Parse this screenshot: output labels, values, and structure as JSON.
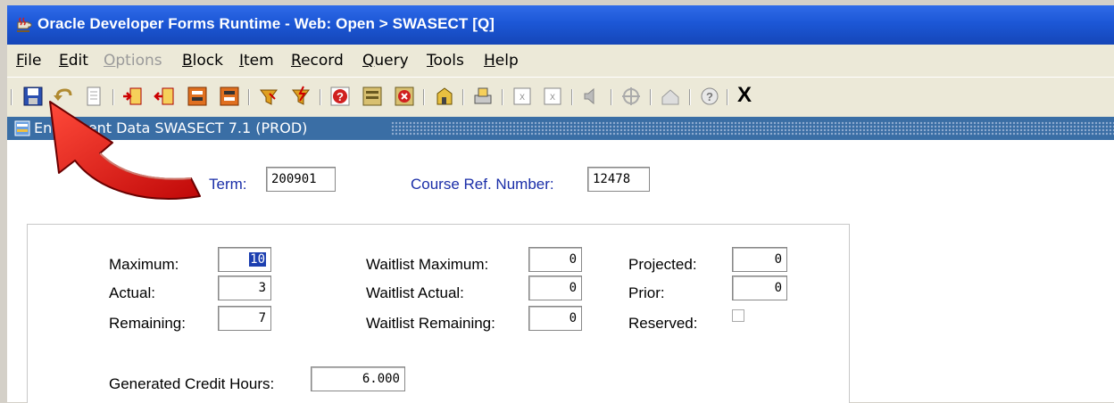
{
  "window": {
    "title": "Oracle Developer Forms Runtime - Web:  Open > SWASECT [Q]"
  },
  "menu": [
    {
      "label": "File",
      "mnemonic": "F",
      "rest": "ile",
      "disabled": false
    },
    {
      "label": "Edit",
      "mnemonic": "E",
      "rest": "dit",
      "disabled": false
    },
    {
      "label": "Options",
      "mnemonic": "O",
      "rest": "ptions",
      "disabled": true
    },
    {
      "label": "Block",
      "mnemonic": "B",
      "rest": "lock",
      "disabled": false
    },
    {
      "label": "Item",
      "mnemonic": "I",
      "rest": "tem",
      "disabled": false
    },
    {
      "label": "Record",
      "mnemonic": "R",
      "rest": "ecord",
      "disabled": false
    },
    {
      "label": "Query",
      "mnemonic": "Q",
      "rest": "uery",
      "disabled": false
    },
    {
      "label": "Tools",
      "mnemonic": "T",
      "rest": "ools",
      "disabled": false
    },
    {
      "label": "Help",
      "mnemonic": "H",
      "rest": "elp",
      "disabled": false
    }
  ],
  "toolbar": {
    "exit_label": "X",
    "icons": [
      "save-icon",
      "rollback-icon",
      "print-icon",
      "insert-record-icon",
      "remove-record-icon",
      "previous-block-icon",
      "next-block-icon",
      "enter-query-icon",
      "execute-query-icon",
      "help-icon",
      "select-icon",
      "cancel-query-icon",
      "copy-icon",
      "print-screen-icon",
      "export-icon",
      "clear-icon",
      "speaker-icon",
      "target-icon",
      "home-icon",
      "question-icon"
    ]
  },
  "form": {
    "title": "Enrollment Data  SWASECT  7.1  (PROD)",
    "term_label": "Term:",
    "term_value": "200901",
    "crn_label": "Course Ref. Number:",
    "crn_value": "12478",
    "maximum_label": "Maximum:",
    "maximum_value": "10",
    "actual_label": "Actual:",
    "actual_value": "3",
    "remaining_label": "Remaining:",
    "remaining_value": "7",
    "wl_maximum_label": "Waitlist Maximum:",
    "wl_maximum_value": "0",
    "wl_actual_label": "Waitlist Actual:",
    "wl_actual_value": "0",
    "wl_remaining_label": "Waitlist Remaining:",
    "wl_remaining_value": "0",
    "projected_label": "Projected:",
    "projected_value": "0",
    "prior_label": "Prior:",
    "prior_value": "0",
    "reserved_label": "Reserved:",
    "reserved_checked": false,
    "credit_hours_label": "Generated Credit Hours:",
    "credit_hours_value": "6.000"
  },
  "colors": {
    "titlebar": "#1c57d6",
    "form_header": "#3a6ea5",
    "label_blue": "#1a2ea8",
    "arrow_red": "#e01010"
  }
}
